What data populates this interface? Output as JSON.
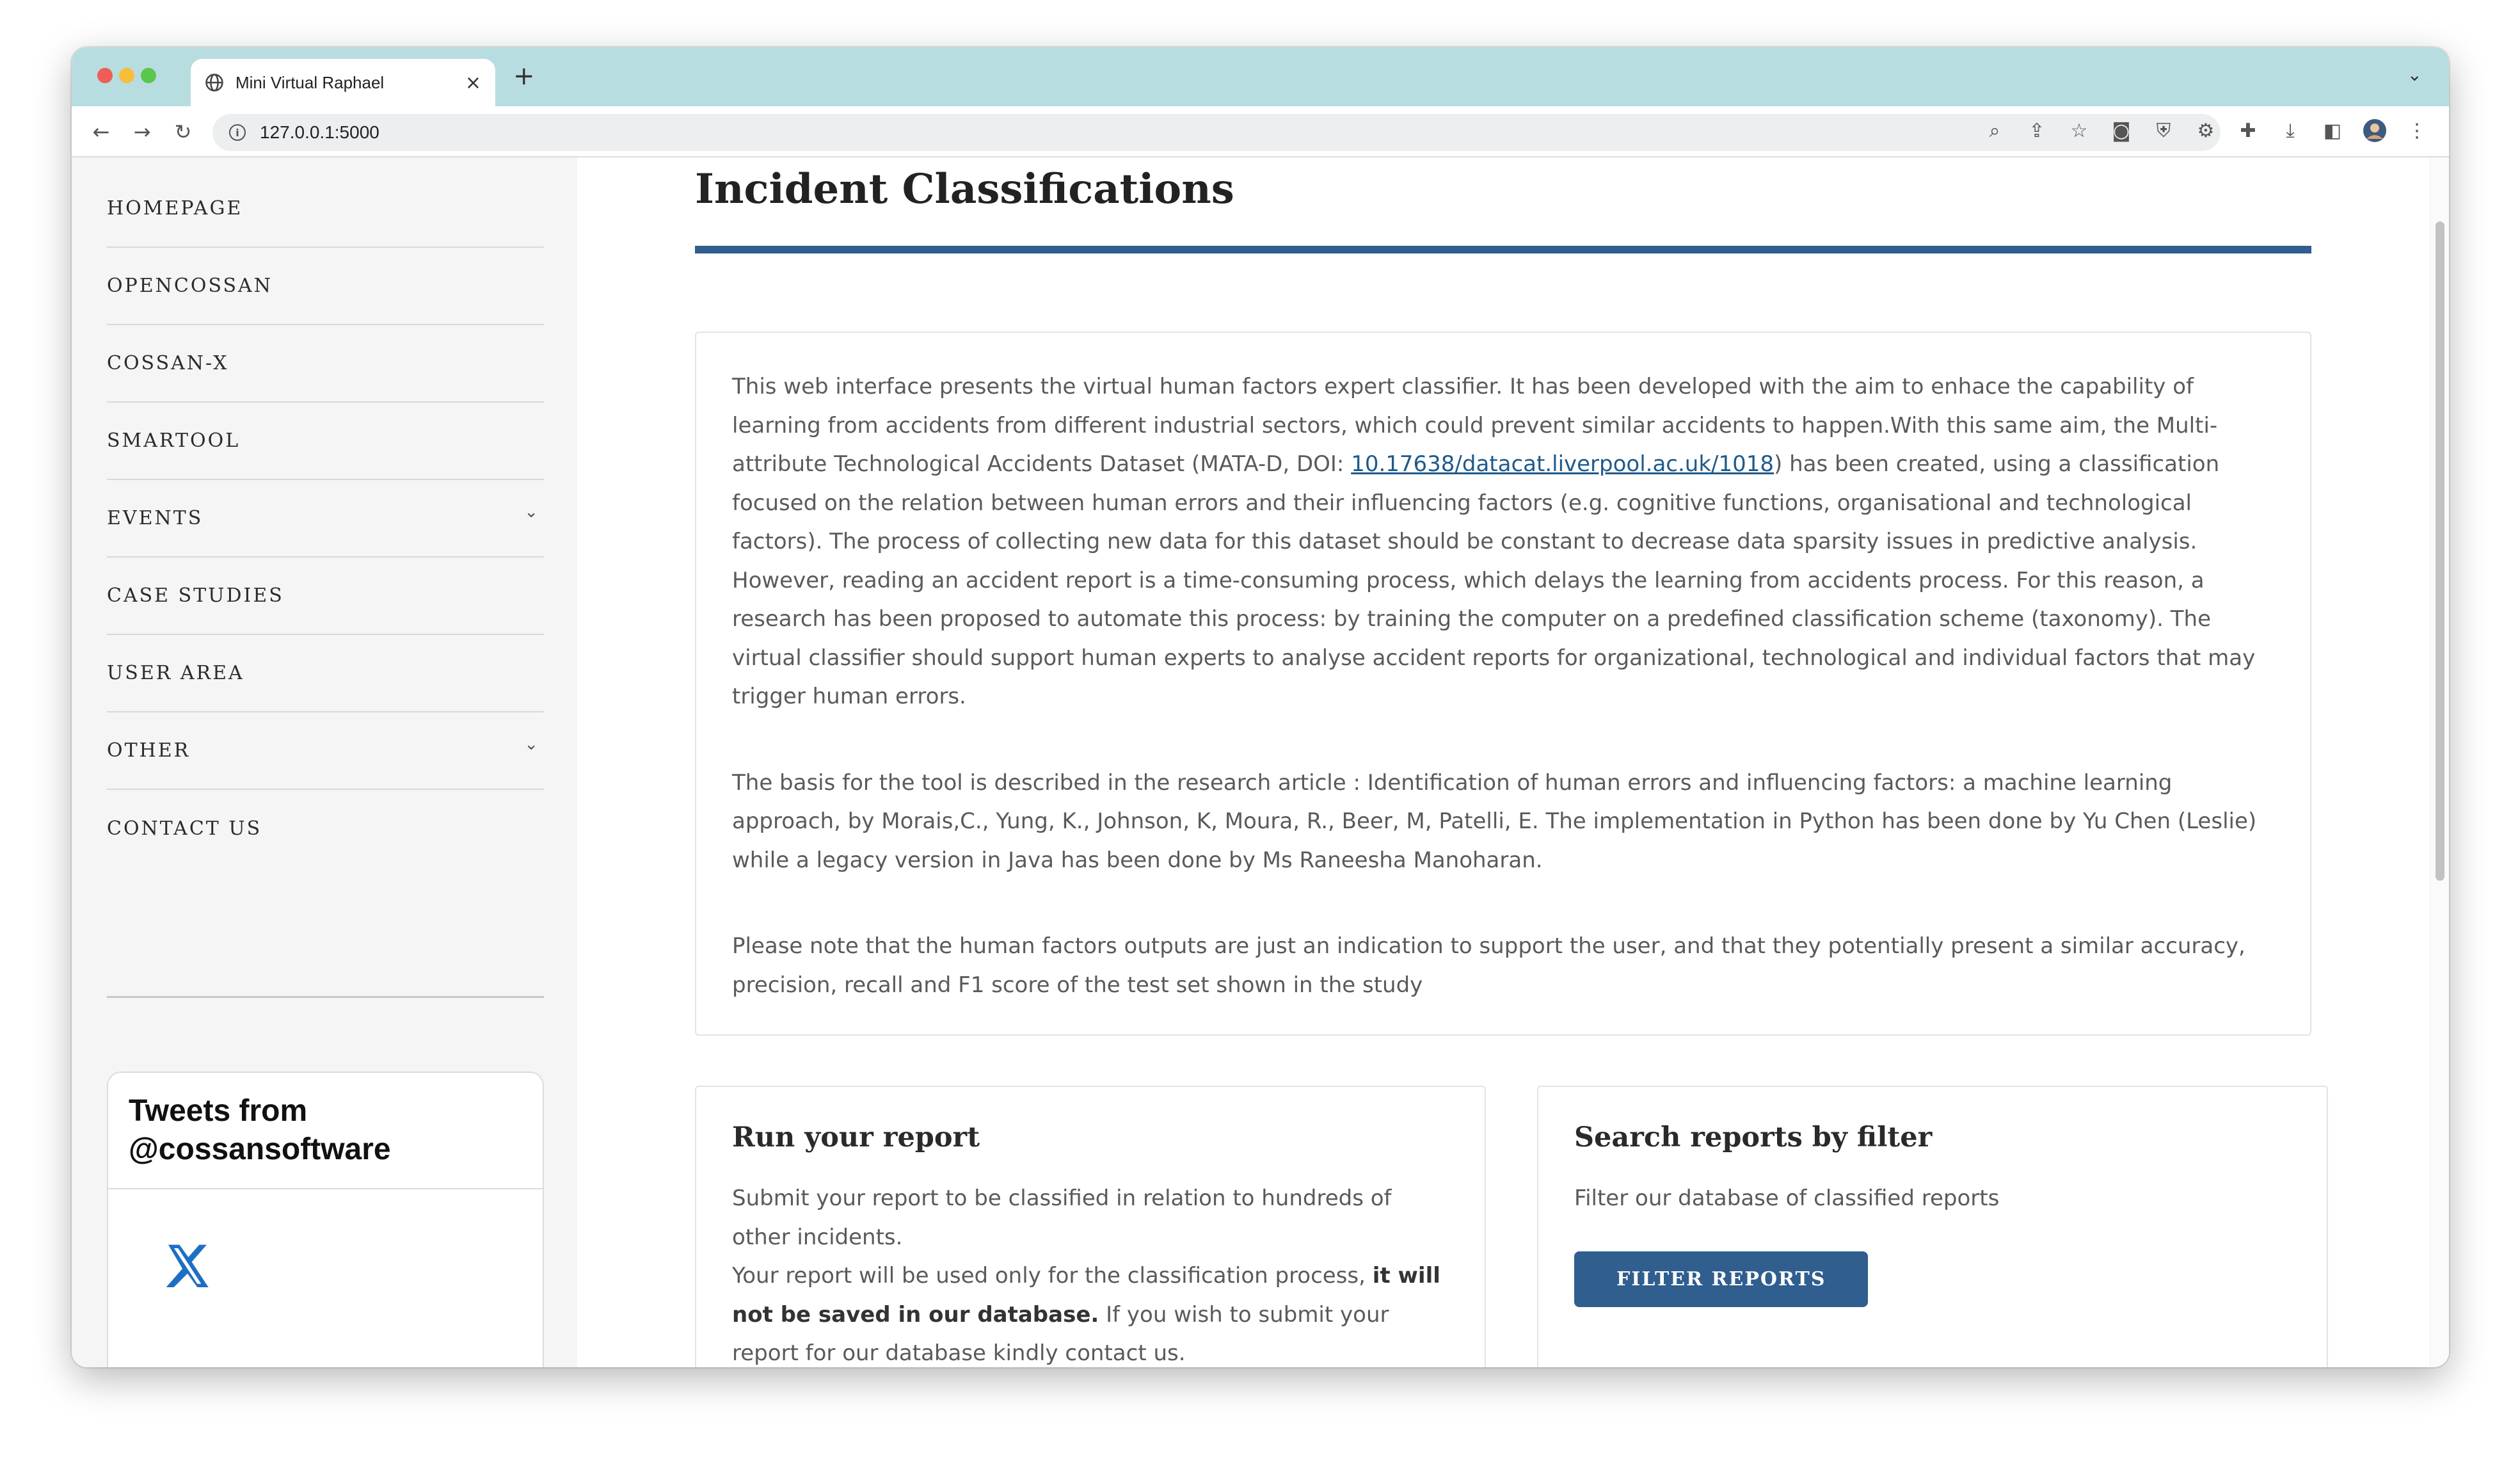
{
  "browser": {
    "tab_title": "Mini Virtual Raphael",
    "tab_close": "×",
    "new_tab": "+",
    "tab_menu": "⌄",
    "url": "127.0.0.1:5000",
    "icons": [
      "back-icon",
      "forward-icon",
      "reload-icon",
      "info-icon",
      "zoom-icon",
      "share-icon",
      "bookmark-star-icon",
      "camera-icon",
      "shield-icon",
      "settings-gear-icon",
      "extensions-puzzle-icon",
      "download-icon",
      "sidebar-panel-icon",
      "profile-avatar-icon",
      "kebab-menu-icon"
    ]
  },
  "sidebar": {
    "items": [
      {
        "label": "HOMEPAGE",
        "has_dropdown": false
      },
      {
        "label": "OPENCOSSAN",
        "has_dropdown": false
      },
      {
        "label": "COSSAN-X",
        "has_dropdown": false
      },
      {
        "label": "SMARTOOL",
        "has_dropdown": false
      },
      {
        "label": "EVENTS",
        "has_dropdown": true
      },
      {
        "label": "CASE STUDIES",
        "has_dropdown": false
      },
      {
        "label": "USER AREA",
        "has_dropdown": false
      },
      {
        "label": "OTHER",
        "has_dropdown": true
      },
      {
        "label": "CONTACT US",
        "has_dropdown": false
      }
    ],
    "twitter": {
      "line1": "Tweets from",
      "line2": "@cossansoftware"
    }
  },
  "main": {
    "title": "Incident Classifications",
    "intro": {
      "p1_before": "This web interface presents the virtual human factors expert classifier. It has been developed with the aim to enhace the capability of learning from accidents from different industrial sectors, which could prevent similar accidents to happen.With this same aim, the Multi-attribute Technological Accidents Dataset (MATA-D, DOI: ",
      "p1_link": "10.17638/datacat.liverpool.ac.uk/1018",
      "p1_after": ") has been created, using a classification focused on the relation between human errors and their influencing factors (e.g. cognitive functions, organisational and technological factors). The process of collecting new data for this dataset should be constant to decrease data sparsity issues in predictive analysis. However, reading an accident report is a time-consuming process, which delays the learning from accidents process. For this reason, a research has been proposed to automate this process: by training the computer on a predefined classification scheme (taxonomy). The virtual classifier should support human experts to analyse accident reports for organizational, technological and individual factors that may trigger human errors.",
      "p2": "The basis for the tool is described in the research article : Identification of human errors and influencing factors: a machine learning approach, by Morais,C., Yung, K., Johnson, K, Moura, R., Beer, M, Patelli, E. The implementation in Python has been done by Yu Chen (Leslie) while a legacy version in Java has been done by Ms Raneesha Manoharan.",
      "p3": "Please note that the human factors outputs are just an indication to support the user, and that they potentially present a similar accuracy, precision, recall and F1 score of the test set shown in the study"
    },
    "run_report": {
      "heading": "Run your report",
      "text1": "Submit your report to be classified in relation to hundreds of other incidents.",
      "text2_before": "Your report will be used only for the classification process, ",
      "text2_bold": "it will not be saved in our database.",
      "text2_after": " If you wish to submit your report for our database kindly contact us."
    },
    "search_reports": {
      "heading": "Search reports by filter",
      "text": "Filter our database of classified reports",
      "button": "FILTER REPORTS"
    }
  }
}
